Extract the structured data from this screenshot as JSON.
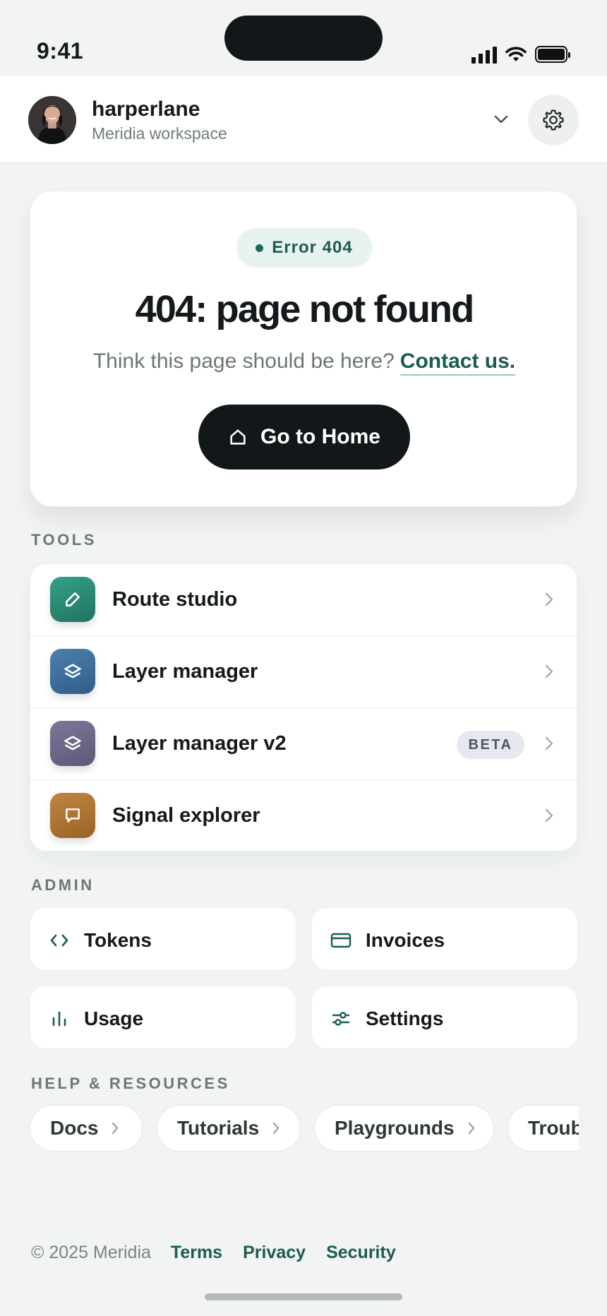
{
  "status_bar": {
    "time": "9:41"
  },
  "header": {
    "user_name": "harperlane",
    "workspace": "Meridia workspace"
  },
  "error": {
    "badge": "Error 404",
    "title": "404: page not found",
    "subtitle": "Think this page should be here?",
    "contact_link": "Contact us.",
    "home_button": "Go to Home"
  },
  "tools": {
    "section_label": "TOOLS",
    "items": [
      {
        "label": "Route studio",
        "icon": "pencil-icon",
        "color": "#2a8a76"
      },
      {
        "label": "Layer manager",
        "icon": "layers-icon",
        "color": "#3f6f9b"
      },
      {
        "label": "Layer manager v2",
        "icon": "layers-icon",
        "color": "#6e6a8c",
        "badge": "BETA"
      },
      {
        "label": "Signal explorer",
        "icon": "message-icon",
        "color": "#b07432"
      }
    ]
  },
  "admin": {
    "section_label": "ADMIN",
    "items": [
      {
        "label": "Tokens",
        "icon": "code-icon"
      },
      {
        "label": "Invoices",
        "icon": "card-icon"
      },
      {
        "label": "Usage",
        "icon": "bar-chart-icon"
      },
      {
        "label": "Settings",
        "icon": "sliders-icon"
      }
    ]
  },
  "help": {
    "section_label": "HELP & RESOURCES",
    "chips": [
      "Docs",
      "Tutorials",
      "Playgrounds",
      "Troub"
    ]
  },
  "footer": {
    "copyright": "© 2025 Meridia",
    "links": [
      "Terms",
      "Privacy",
      "Security"
    ]
  },
  "colors": {
    "accent": "#1b5c50",
    "dark": "#121819",
    "background": "#f2f4f4"
  }
}
